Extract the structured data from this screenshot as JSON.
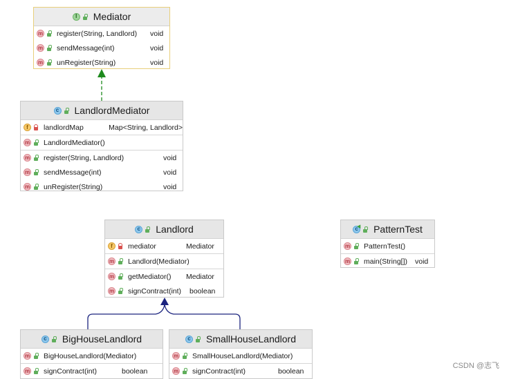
{
  "classes": {
    "mediator": {
      "name": "Mediator",
      "kind_icon": "interface-icon",
      "methods": [
        {
          "name": "register(String, Landlord)",
          "type": "void"
        },
        {
          "name": "sendMessage(int)",
          "type": "void"
        },
        {
          "name": "unRegister(String)",
          "type": "void"
        }
      ]
    },
    "landlord_mediator": {
      "name": "LandlordMediator",
      "kind_icon": "class-icon",
      "fields": [
        {
          "name": "landlordMap",
          "type": "Map<String, Landlord>"
        }
      ],
      "constructors": [
        {
          "name": "LandlordMediator()"
        }
      ],
      "methods": [
        {
          "name": "register(String, Landlord)",
          "type": "void"
        },
        {
          "name": "sendMessage(int)",
          "type": "void"
        },
        {
          "name": "unRegister(String)",
          "type": "void"
        }
      ]
    },
    "landlord": {
      "name": "Landlord",
      "kind_icon": "class-icon",
      "fields": [
        {
          "name": "mediator",
          "type": "Mediator"
        }
      ],
      "constructors": [
        {
          "name": "Landlord(Mediator)"
        }
      ],
      "methods": [
        {
          "name": "getMediator()",
          "type": "Mediator"
        },
        {
          "name": "signContract(int)",
          "type": "boolean"
        }
      ]
    },
    "pattern_test": {
      "name": "PatternTest",
      "kind_icon": "main-class-icon",
      "constructors": [
        {
          "name": "PatternTest()"
        }
      ],
      "methods": [
        {
          "name": "main(String[])",
          "type": "void"
        }
      ]
    },
    "big_house_landlord": {
      "name": "BigHouseLandlord",
      "kind_icon": "class-icon",
      "constructors": [
        {
          "name": "BigHouseLandlord(Mediator)"
        }
      ],
      "methods": [
        {
          "name": "signContract(int)",
          "type": "boolean"
        }
      ]
    },
    "small_house_landlord": {
      "name": "SmallHouseLandlord",
      "kind_icon": "class-icon",
      "constructors": [
        {
          "name": "SmallHouseLandlord(Mediator)"
        }
      ],
      "methods": [
        {
          "name": "signContract(int)",
          "type": "boolean"
        }
      ]
    }
  },
  "icon_letters": {
    "method": "m",
    "field": "f",
    "class": "c",
    "interface": "I"
  },
  "colors": {
    "realization": "#1e8a1e",
    "generalization": "#1a237e"
  },
  "watermark": "CSDN @志飞"
}
